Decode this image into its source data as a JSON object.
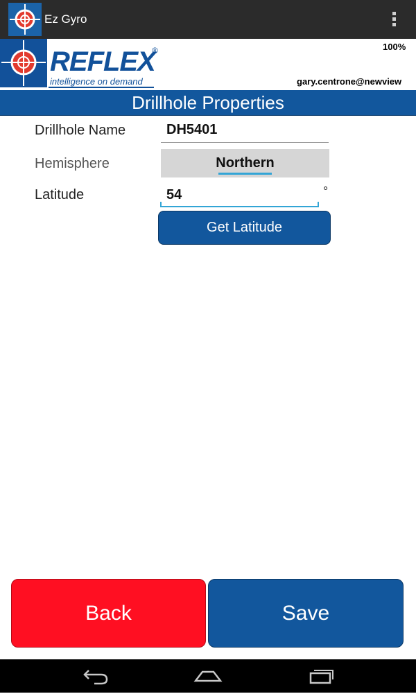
{
  "app": {
    "title": "Ez Gyro"
  },
  "header": {
    "brand": "REFLEX",
    "registered": "®",
    "tagline": "intelligence on demand",
    "battery": "100%",
    "user_email": "gary.centrone@newview"
  },
  "page": {
    "title": "Drillhole Properties"
  },
  "form": {
    "drillhole_name": {
      "label": "Drillhole Name",
      "value": "DH5401"
    },
    "hemisphere": {
      "label": "Hemisphere",
      "value": "Northern"
    },
    "latitude": {
      "label": "Latitude",
      "value": "54",
      "unit": "°"
    },
    "get_latitude_label": "Get Latitude"
  },
  "footer": {
    "back_label": "Back",
    "save_label": "Save"
  },
  "colors": {
    "brand_blue": "#12579d",
    "back_red": "#ff0f22",
    "focus_cyan": "#33a5d6",
    "actionbar": "#2b2b2b"
  },
  "icons": [
    "app-logo-icon",
    "overflow-menu-icon",
    "back-nav-icon",
    "home-nav-icon",
    "recents-nav-icon"
  ]
}
